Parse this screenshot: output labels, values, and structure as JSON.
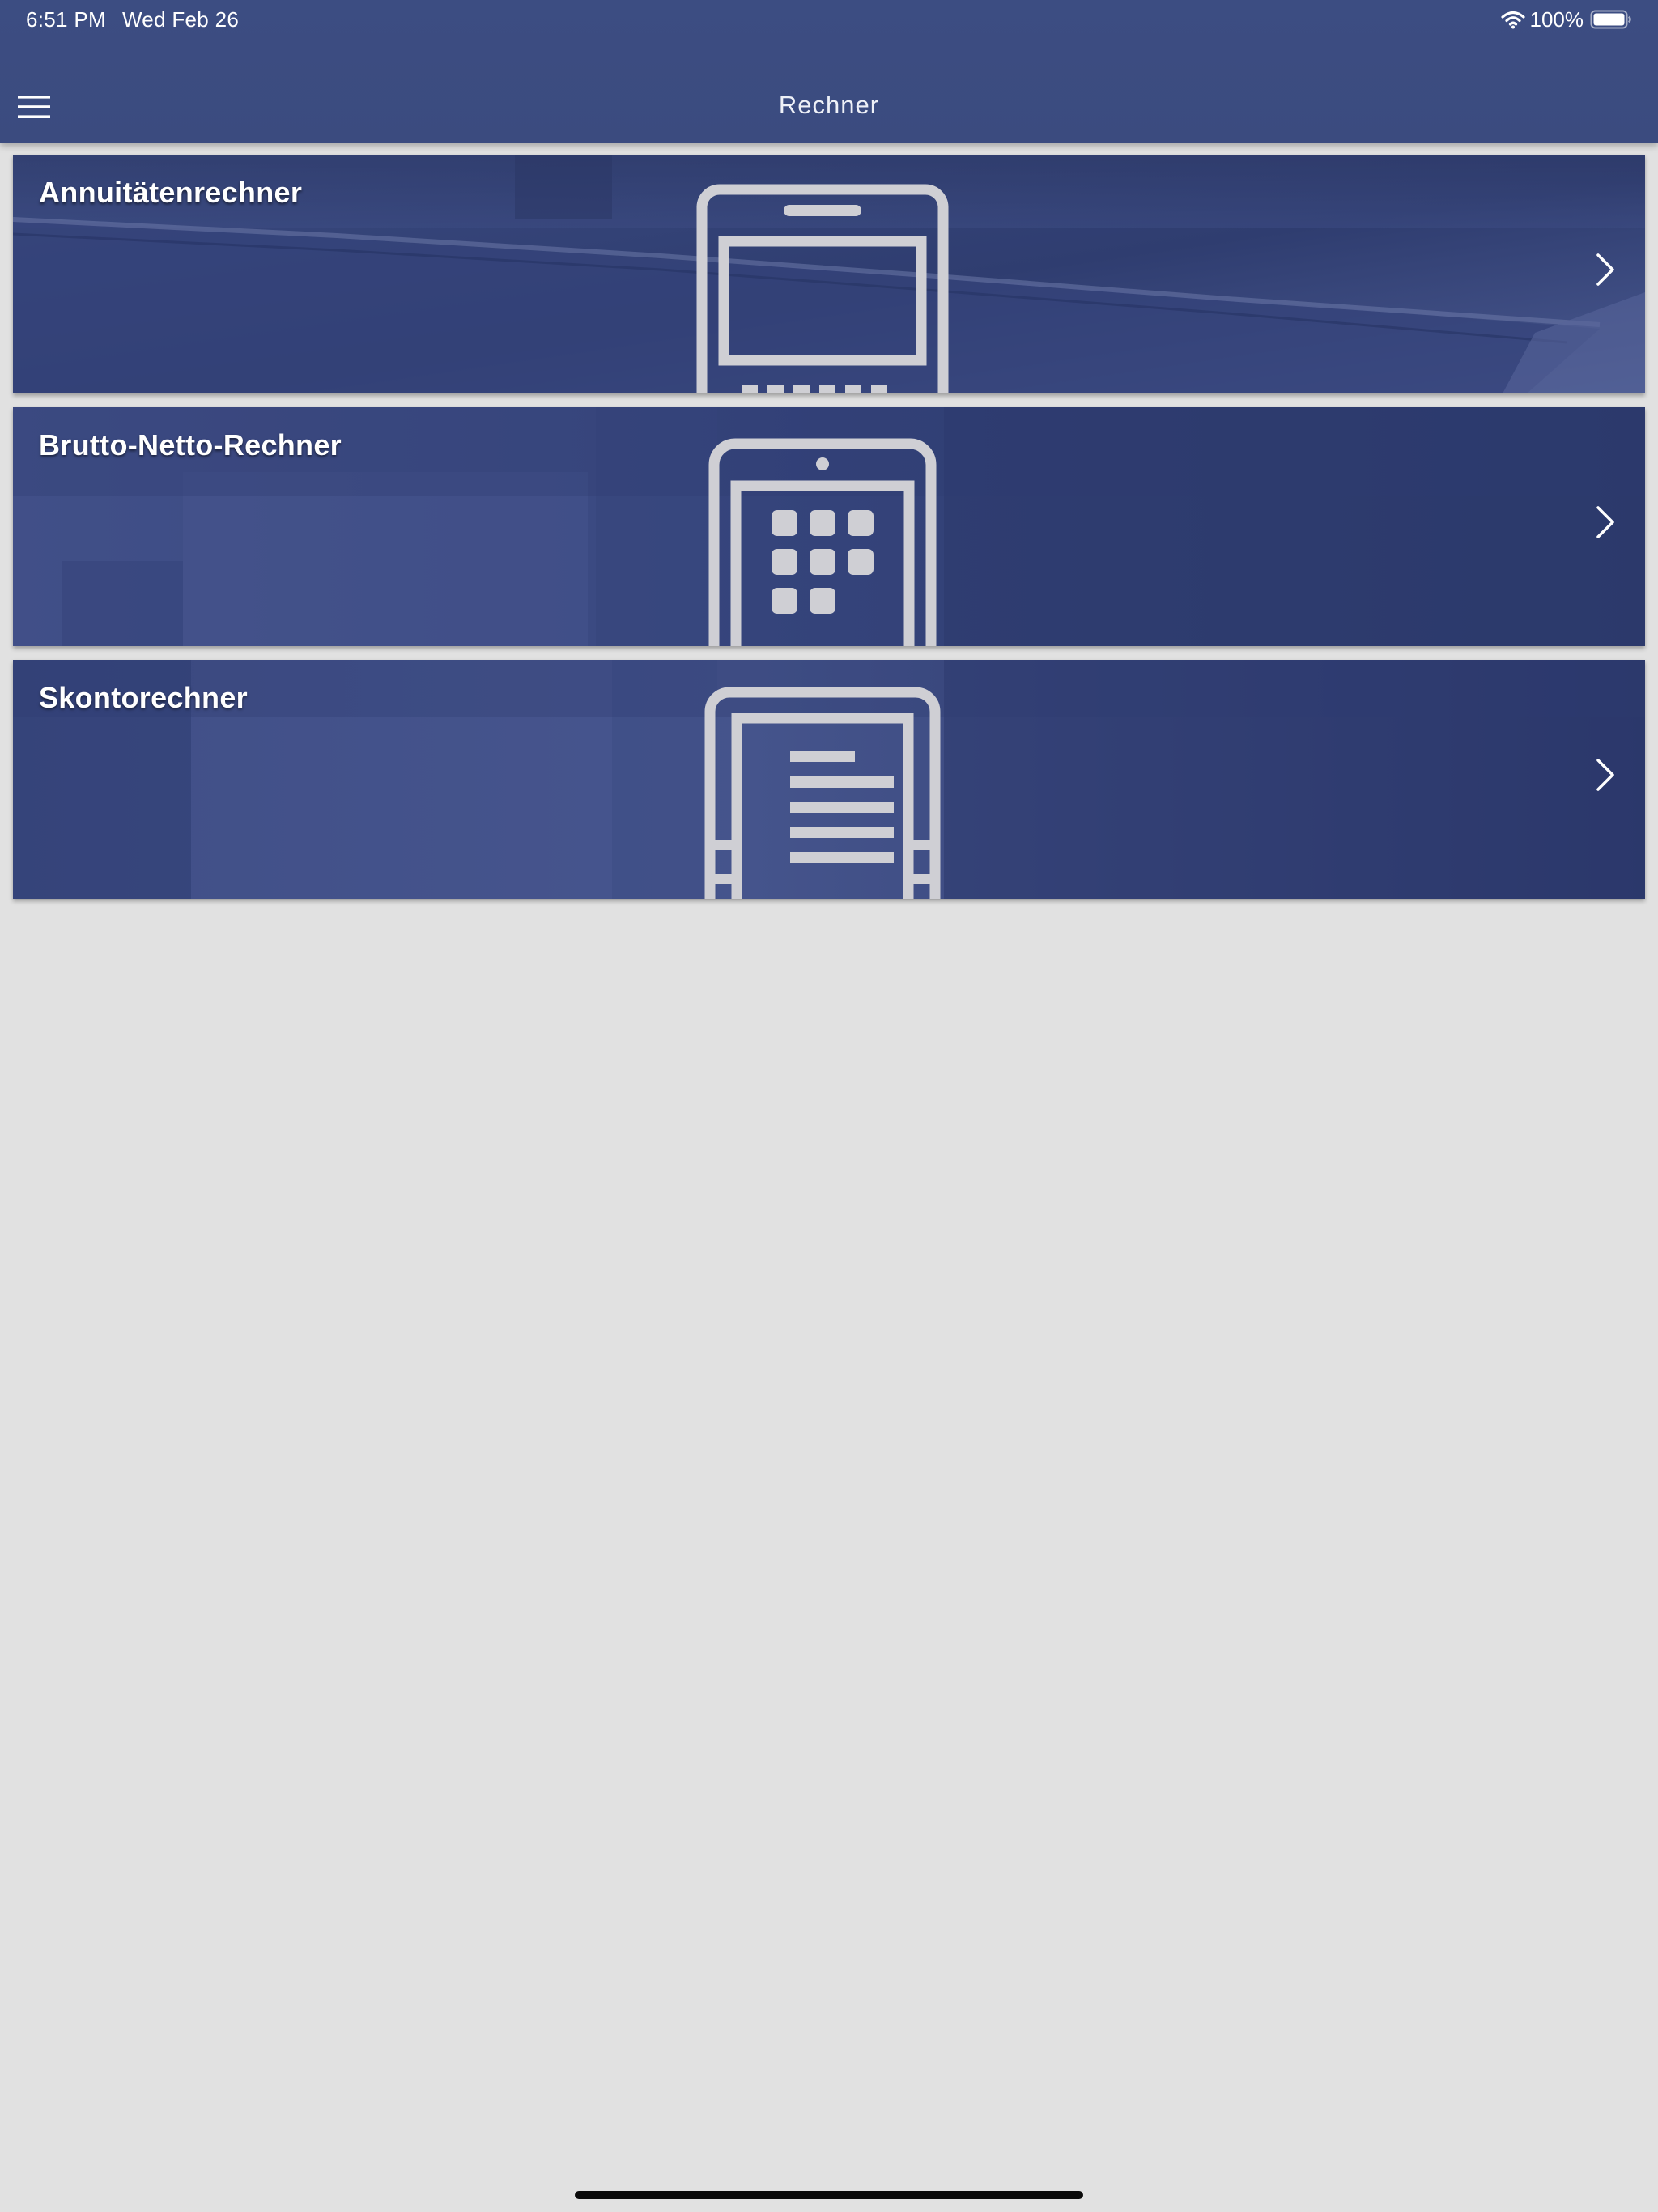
{
  "status_bar": {
    "time": "6:51 PM",
    "date": "Wed Feb 26",
    "battery": "100%",
    "icons": [
      "wifi-icon",
      "battery-icon"
    ]
  },
  "nav": {
    "title": "Rechner",
    "menu_icon": "hamburger-menu-icon"
  },
  "cards": [
    {
      "title": "Annuitätenrechner",
      "icon": "tablet-screen-icon"
    },
    {
      "title": "Brutto-Netto-Rechner",
      "icon": "calculator-keypad-icon"
    },
    {
      "title": "Skontorechner",
      "icon": "document-list-icon"
    }
  ],
  "colors": {
    "header": "#3c4d82",
    "card": "#3a4a80",
    "background": "#e1e1e1",
    "icon": "#cfcfd4"
  }
}
